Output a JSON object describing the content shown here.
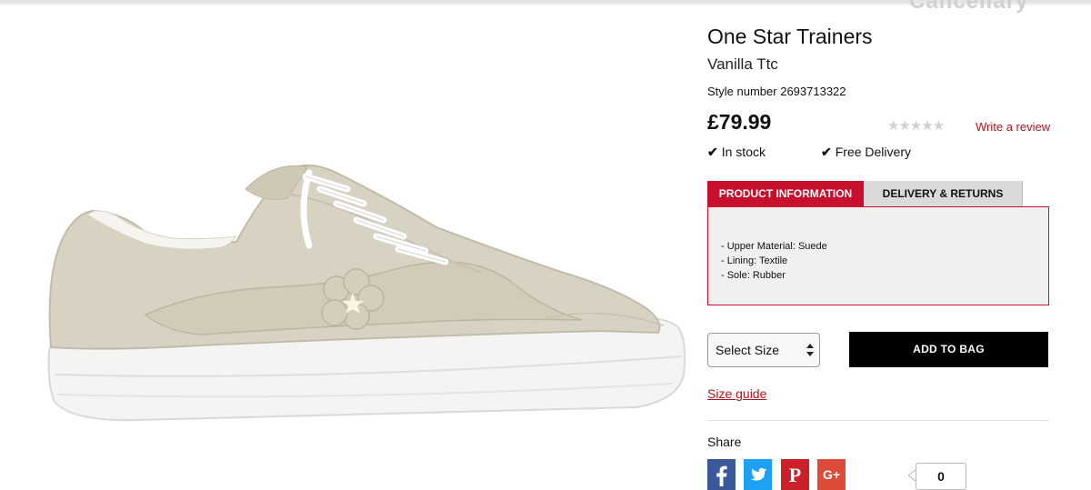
{
  "header": {
    "cut_heading": "Cancellary"
  },
  "product": {
    "title": "One Star Trainers",
    "colour": "Vanilla Ttc",
    "style_label": "Style number",
    "style_number": "2693713322",
    "price": "£79.99",
    "rating": {
      "stars": 0,
      "max": 5,
      "glyphs": "★★★★★"
    },
    "write_review": "Write a review",
    "stock": "In stock",
    "delivery": "Free Delivery",
    "image": {
      "alt": "Off-white suede low-top trainer with white laces and flower-shaped side patch",
      "colors": {
        "suede": "#d8d2c3",
        "sole": "#f4f4f2",
        "laces": "#ffffff"
      }
    }
  },
  "tabs": [
    {
      "label": "PRODUCT INFORMATION",
      "active": true
    },
    {
      "label": "DELIVERY & RETURNS",
      "active": false
    }
  ],
  "specs": [
    "- Upper Material: Suede",
    "- Lining: Textile",
    "- Sole: Rubber"
  ],
  "size_select": {
    "value": "Select Size"
  },
  "add_to_bag": "ADD TO BAG",
  "size_guide": "Size guide",
  "share": {
    "label": "Share",
    "networks": [
      {
        "name": "facebook",
        "glyph": "f",
        "color": "#3b5998"
      },
      {
        "name": "twitter",
        "glyph": "twitter-bird",
        "color": "#1da1f2"
      },
      {
        "name": "pinterest",
        "glyph": "p",
        "color": "#cb2027"
      },
      {
        "name": "google-plus",
        "glyph": "G+",
        "color": "#dd4b39"
      }
    ],
    "count": "0"
  },
  "colors": {
    "accent": "#c8102e",
    "link": "#b5121b",
    "button": "#000000"
  }
}
